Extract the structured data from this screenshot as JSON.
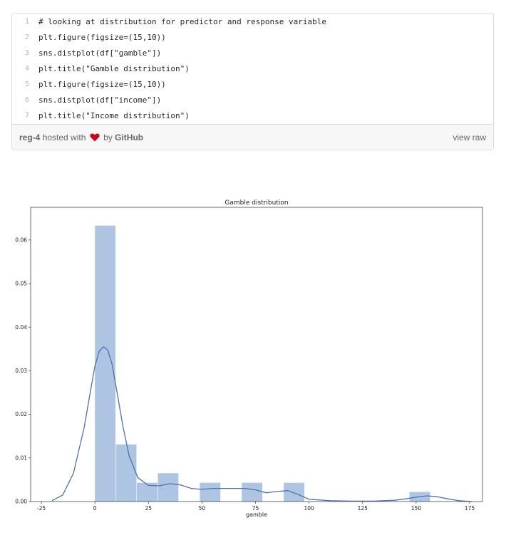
{
  "gist": {
    "lines": [
      {
        "num": "1",
        "code": "# looking at distribution for predictor and response variable"
      },
      {
        "num": "2",
        "code": "plt.figure(figsize=(15,10))"
      },
      {
        "num": "3",
        "code": "sns.distplot(df[\"gamble\"])"
      },
      {
        "num": "4",
        "code": "plt.title(\"Gamble distribution\")"
      },
      {
        "num": "5",
        "code": "plt.figure(figsize=(15,10))"
      },
      {
        "num": "6",
        "code": "sns.distplot(df[\"income\"])"
      },
      {
        "num": "7",
        "code": "plt.title(\"Income distribution\")"
      }
    ],
    "footer": {
      "file": "reg-4",
      "hosted_with": "hosted with",
      "by": "by",
      "github": "GitHub",
      "view_raw": "view raw"
    },
    "colors": {
      "heart": "#d0021b",
      "footer_bg": "#f7f7f7",
      "border": "#dcdcdc"
    }
  },
  "chart_data": {
    "type": "bar",
    "title": "Gamble distribution",
    "xlabel": "gamble",
    "ylabel": "",
    "xlim": [
      -30,
      181
    ],
    "ylim": [
      0,
      0.0675
    ],
    "xticks": [
      -25,
      0,
      25,
      50,
      75,
      100,
      125,
      150,
      175
    ],
    "yticks": [
      0.0,
      0.01,
      0.02,
      0.03,
      0.04,
      0.05,
      0.06
    ],
    "ytick_labels": [
      "0.00",
      "0.01",
      "0.02",
      "0.03",
      "0.04",
      "0.05",
      "0.06"
    ],
    "bar_color": "#aec4e3",
    "bins": [
      {
        "x0": 0,
        "x1": 9.8,
        "value": 0.0633
      },
      {
        "x0": 9.8,
        "x1": 19.6,
        "value": 0.0131
      },
      {
        "x0": 19.6,
        "x1": 29.4,
        "value": 0.0043
      },
      {
        "x0": 29.4,
        "x1": 39.2,
        "value": 0.0065
      },
      {
        "x0": 39.2,
        "x1": 49.0,
        "value": 0.0
      },
      {
        "x0": 49.0,
        "x1": 58.8,
        "value": 0.0043
      },
      {
        "x0": 58.8,
        "x1": 68.6,
        "value": 0.0
      },
      {
        "x0": 68.6,
        "x1": 78.4,
        "value": 0.0043
      },
      {
        "x0": 78.4,
        "x1": 88.2,
        "value": 0.0
      },
      {
        "x0": 88.2,
        "x1": 98.0,
        "value": 0.0043
      },
      {
        "x0": 146.9,
        "x1": 156.7,
        "value": 0.0022
      }
    ],
    "kde_color": "#4c72b0",
    "kde": {
      "x": [
        -20,
        -15,
        -10,
        -5,
        -2,
        0,
        2,
        4,
        6,
        8,
        10,
        13,
        16,
        20,
        25,
        30,
        35,
        40,
        45,
        50,
        55,
        60,
        65,
        70,
        75,
        80,
        85,
        90,
        95,
        100,
        110,
        120,
        130,
        140,
        145,
        150,
        155,
        160,
        165,
        170,
        176
      ],
      "y": [
        0.0002,
        0.0015,
        0.0065,
        0.017,
        0.0255,
        0.031,
        0.0345,
        0.0355,
        0.0348,
        0.0315,
        0.026,
        0.0175,
        0.0105,
        0.0055,
        0.0037,
        0.0036,
        0.0041,
        0.0038,
        0.003,
        0.0028,
        0.003,
        0.003,
        0.003,
        0.003,
        0.0027,
        0.002,
        0.0023,
        0.0025,
        0.0016,
        0.0005,
        0.0002,
        0.0001,
        0.0001,
        0.0003,
        0.0006,
        0.001,
        0.0013,
        0.0011,
        0.0006,
        0.0002,
        0.0
      ]
    }
  }
}
